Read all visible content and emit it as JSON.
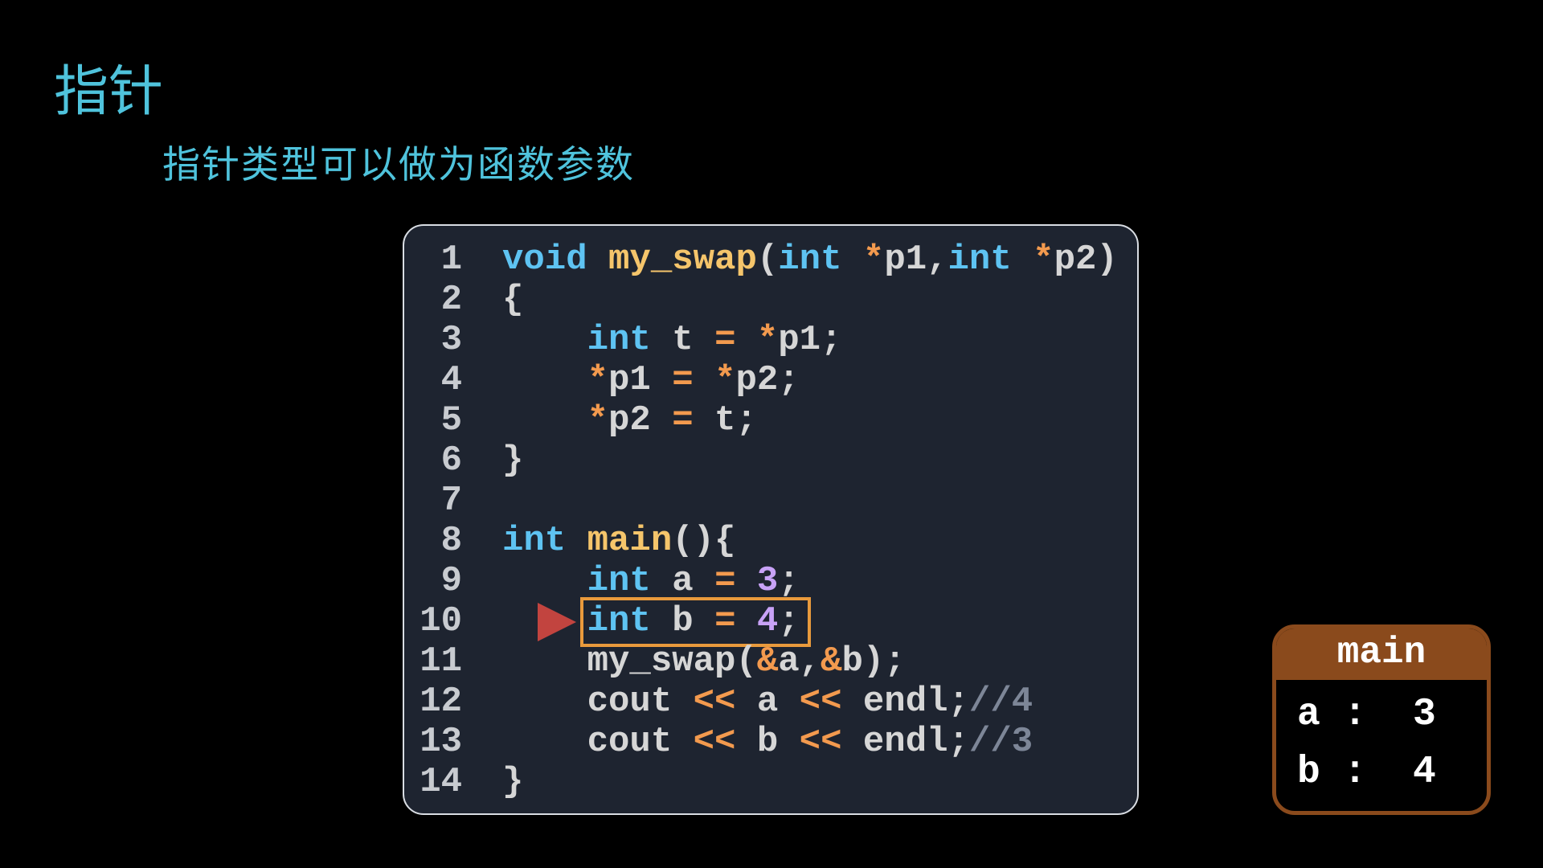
{
  "title": "指针",
  "subtitle": "指针类型可以做为函数参数",
  "colors": {
    "keyword": "#5ec3f2",
    "function": "#f5c56b",
    "operator": "#f39a4e",
    "number": "#c8a2f7",
    "comment": "#7d8697",
    "highlight": "#e99a3c",
    "arrow": "#c2443f",
    "frame": "#8a4a1c"
  },
  "code": [
    {
      "n": "1",
      "t": [
        [
          "kw",
          "void"
        ],
        [
          "tx",
          " "
        ],
        [
          "fn",
          "my_swap"
        ],
        [
          "tx",
          "("
        ],
        [
          "kw",
          "int"
        ],
        [
          "tx",
          " "
        ],
        [
          "op",
          "*"
        ],
        [
          "tx",
          "p1,"
        ],
        [
          "kw",
          "int"
        ],
        [
          "tx",
          " "
        ],
        [
          "op",
          "*"
        ],
        [
          "tx",
          "p2)"
        ]
      ]
    },
    {
      "n": "2",
      "t": [
        [
          "tx",
          "{"
        ]
      ]
    },
    {
      "n": "3",
      "t": [
        [
          "tx",
          "    "
        ],
        [
          "kw",
          "int"
        ],
        [
          "tx",
          " t "
        ],
        [
          "op",
          "="
        ],
        [
          "tx",
          " "
        ],
        [
          "op",
          "*"
        ],
        [
          "tx",
          "p1;"
        ]
      ]
    },
    {
      "n": "4",
      "t": [
        [
          "tx",
          "    "
        ],
        [
          "op",
          "*"
        ],
        [
          "tx",
          "p1 "
        ],
        [
          "op",
          "="
        ],
        [
          "tx",
          " "
        ],
        [
          "op",
          "*"
        ],
        [
          "tx",
          "p2;"
        ]
      ]
    },
    {
      "n": "5",
      "t": [
        [
          "tx",
          "    "
        ],
        [
          "op",
          "*"
        ],
        [
          "tx",
          "p2 "
        ],
        [
          "op",
          "="
        ],
        [
          "tx",
          " t;"
        ]
      ]
    },
    {
      "n": "6",
      "t": [
        [
          "tx",
          "}"
        ]
      ]
    },
    {
      "n": "7",
      "t": []
    },
    {
      "n": "8",
      "t": [
        [
          "kw",
          "int"
        ],
        [
          "tx",
          " "
        ],
        [
          "fn",
          "main"
        ],
        [
          "tx",
          "(){"
        ]
      ]
    },
    {
      "n": "9",
      "t": [
        [
          "tx",
          "    "
        ],
        [
          "kw",
          "int"
        ],
        [
          "tx",
          " a "
        ],
        [
          "op",
          "="
        ],
        [
          "tx",
          " "
        ],
        [
          "num",
          "3"
        ],
        [
          "tx",
          ";"
        ]
      ]
    },
    {
      "n": "10",
      "t": [
        [
          "tx",
          "    "
        ],
        [
          "kw",
          "int"
        ],
        [
          "tx",
          " b "
        ],
        [
          "op",
          "="
        ],
        [
          "tx",
          " "
        ],
        [
          "num",
          "4"
        ],
        [
          "tx",
          ";"
        ]
      ]
    },
    {
      "n": "11",
      "t": [
        [
          "tx",
          "    my_swap("
        ],
        [
          "op",
          "&"
        ],
        [
          "tx",
          "a,"
        ],
        [
          "op",
          "&"
        ],
        [
          "tx",
          "b);"
        ]
      ]
    },
    {
      "n": "12",
      "t": [
        [
          "tx",
          "    cout "
        ],
        [
          "op",
          "<<"
        ],
        [
          "tx",
          " a "
        ],
        [
          "op",
          "<<"
        ],
        [
          "tx",
          " endl;"
        ],
        [
          "cm",
          "//4"
        ]
      ]
    },
    {
      "n": "13",
      "t": [
        [
          "tx",
          "    cout "
        ],
        [
          "op",
          "<<"
        ],
        [
          "tx",
          " b "
        ],
        [
          "op",
          "<<"
        ],
        [
          "tx",
          " endl;"
        ],
        [
          "cm",
          "//3"
        ]
      ]
    },
    {
      "n": "14",
      "t": [
        [
          "tx",
          "}"
        ]
      ]
    }
  ],
  "current_line": "10",
  "stack_frame": {
    "name": "main",
    "vars": [
      {
        "name": "a",
        "sep": ":",
        "value": "3"
      },
      {
        "name": "b",
        "sep": ":",
        "value": "4"
      }
    ]
  }
}
